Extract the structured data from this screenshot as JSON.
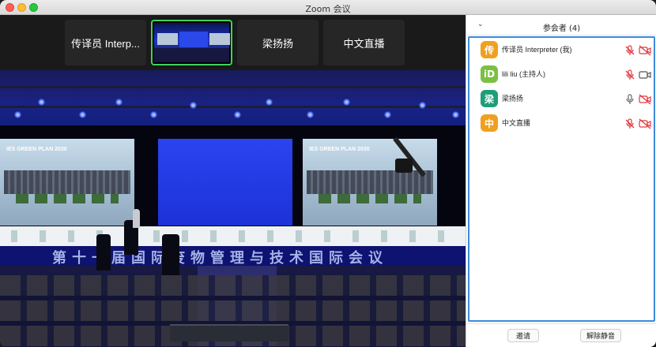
{
  "window": {
    "title": "Zoom 会议"
  },
  "thumbnails": [
    {
      "label": "传译员 Interp..."
    },
    {
      "label": ""
    },
    {
      "label": "梁扬扬"
    },
    {
      "label": "中文直播"
    }
  ],
  "stage": {
    "screen_heading": "IES GREEN PLAN 2030",
    "headline": "第十一届国际废物管理与技术国际会议"
  },
  "panel": {
    "title": "参会者 (4)",
    "participants": [
      {
        "initial": "传",
        "name": "传译员 Interpreter (我)",
        "avatar_color": "#f0a020",
        "mic": "muted",
        "video": "off"
      },
      {
        "initial": "iD",
        "name": "lili liu (主持人)",
        "avatar_color": "#7ac142",
        "mic": "muted",
        "video": "on"
      },
      {
        "initial": "梁",
        "name": "梁扬扬",
        "avatar_color": "#1e9e78",
        "mic": "on",
        "video": "off"
      },
      {
        "initial": "中",
        "name": "中文直播",
        "avatar_color": "#f0a020",
        "mic": "muted",
        "video": "off"
      }
    ],
    "invite_label": "邀请",
    "unmute_all_label": "解除静音"
  },
  "colors": {
    "muted_red": "#e0383e",
    "active_border": "#3fd35b",
    "list_border": "#3d8ad9"
  }
}
